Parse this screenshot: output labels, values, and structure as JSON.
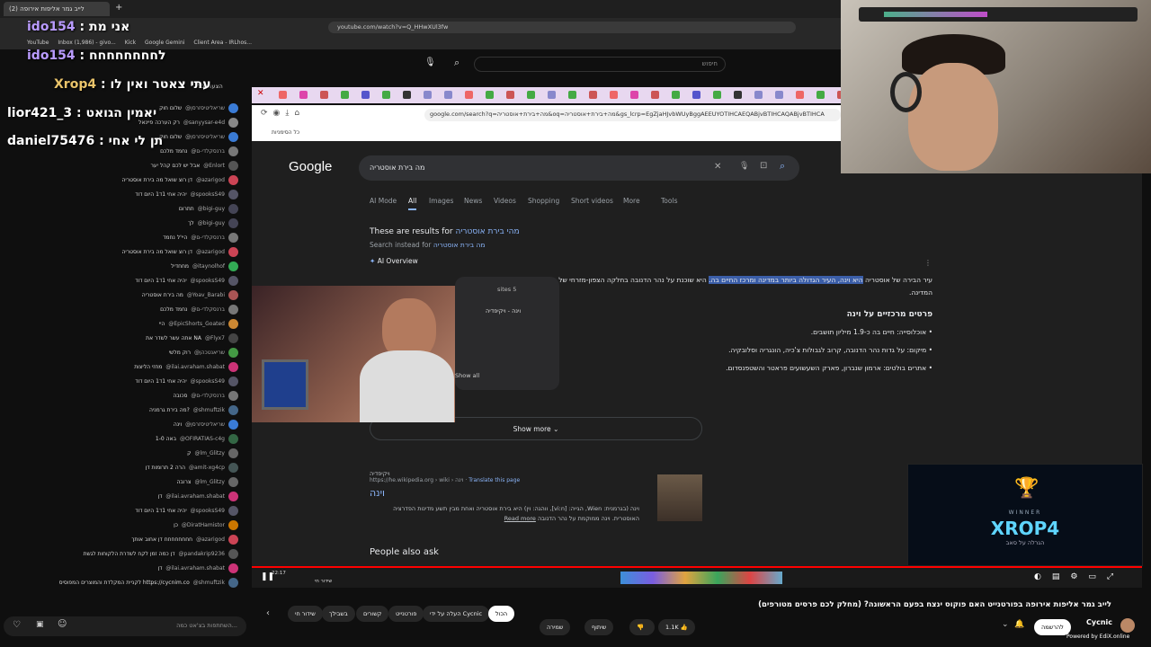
{
  "yt_browser": {
    "tab_title": "(2) לייב גמר אליפות אירופה",
    "url": "youtube.com/watch?v=Q_HHwXUl3fw",
    "bookmarks": [
      "YouTube",
      "Inbox (1,986) - givo...",
      "Kick",
      "Google Gemini",
      "Client Area - IRLhos..."
    ],
    "search_placeholder": "חיפוש"
  },
  "overlay_chat": [
    {
      "user": "ido154",
      "text": ": אני מת"
    },
    {
      "user": "ido154",
      "text": ": לחחחחחחחח"
    },
    {
      "user": "Xrop4",
      "text": ": עתי צאטר ואין לו"
    },
    {
      "user": "lior421_3",
      "text": ": יאמין הגואט"
    },
    {
      "user": "daniel75476",
      "text": ": תן לי אחי"
    }
  ],
  "chat": {
    "header": "הצעות בל",
    "messages": [
      {
        "user": "@שריאליטיסזרסן",
        "text": "שלום חוק",
        "color": "#3a7bd5"
      },
      {
        "user": "@sanyysar-e4d",
        "text": "רק הערכה פיינאל",
        "color": "#888"
      },
      {
        "user": "@שריאליטיסזרסן",
        "text": "שלום חוק",
        "color": "#3a7bd5"
      },
      {
        "user": "@ברנסקלדי-ם",
        "text": "נחמד מלכם",
        "color": "#777"
      },
      {
        "user": "@Enlort",
        "text": "אבל יש לכם קהל יער",
        "color": "#555"
      },
      {
        "user": "@azarigod",
        "text": "דן רוצ שואל מה בירת אוסטריה",
        "color": "#c45"
      },
      {
        "user": "@spooksS49",
        "text": "יהיה אחי 1ד1 היום דוד",
        "color": "#556"
      },
      {
        "user": "@bigi-guy",
        "text": "תתרום",
        "color": "#445"
      },
      {
        "user": "@bigi-guy",
        "text": "לך",
        "color": "#445"
      },
      {
        "user": "@ברנסקלדי-ם",
        "text": "היי'ל נחמד",
        "color": "#777"
      },
      {
        "user": "@azarigod",
        "text": "דן רוצ שואל מה בירת אוסטריה",
        "color": "#c45"
      },
      {
        "user": "@itaynolhof",
        "text": "מחחדיל",
        "color": "#3a5"
      },
      {
        "user": "@spooksS49",
        "text": "יהיה אחי 1ד1 היום דוד",
        "color": "#556"
      },
      {
        "user": "@Yoav_Barabi",
        "text": "מה בירת אוסטריה",
        "color": "#a55"
      },
      {
        "user": "@ברנסקלדי-ם",
        "text": "נחמד מלכם",
        "color": "#777"
      },
      {
        "user": "@EpicShorts_Goated",
        "text": "היי",
        "color": "#c83"
      },
      {
        "user": "@Flyx7",
        "text": "אתה עשר לשדר את NA",
        "color": "#444"
      },
      {
        "user": "@שריאנטכהן",
        "text": "רוק מלשי",
        "color": "#494"
      },
      {
        "user": "@ilai.avraham.shabat",
        "text": "מחזי הליצות",
        "color": "#c37"
      },
      {
        "user": "@spooksS49",
        "text": "יהיה אחי 1ד1 היום דוד",
        "color": "#556"
      },
      {
        "user": "@ברנסקלדי-ם",
        "text": "סכובה",
        "color": "#777"
      },
      {
        "user": "@shmuftzik",
        "text": "מה בירת גרמניה?",
        "color": "#468"
      },
      {
        "user": "@שריאליטיסזרסן",
        "text": "וינה",
        "color": "#3a7bd5"
      },
      {
        "user": "@OFIRATIAS-c4g",
        "text": "1-0 באה",
        "color": "#364"
      },
      {
        "user": "@lm_Glitzy",
        "text": "ק",
        "color": "#666"
      },
      {
        "user": "@amit-xg4cp",
        "text": "הרה 2 תרומות דן",
        "color": "#455"
      },
      {
        "user": "@lm_Glitzy",
        "text": "צרובה",
        "color": "#666"
      },
      {
        "user": "@ilai.avraham.shabat",
        "text": "דן",
        "color": "#c37"
      },
      {
        "user": "@spooksS49",
        "text": "יהיה אחי 1ד1 היום דוד",
        "color": "#556"
      },
      {
        "user": "@DiratHamistor",
        "text": "כן",
        "color": "#c70"
      },
      {
        "user": "@azarigod",
        "text": "חחחחחחחח דן אחוב אותך",
        "color": "#c45"
      },
      {
        "user": "@pandakrip9236",
        "text": "דן כמה זמן לקח לשדרת הלקוחות לגשת",
        "color": "#555"
      },
      {
        "user": "@ilai.avraham.shabat",
        "text": "דן",
        "color": "#c37"
      },
      {
        "user": "@shmuftzik",
        "text": "לקניית המקלדת והמוצרים המפוסיס https://cycnim.co",
        "color": "#468"
      }
    ],
    "input_placeholder": "השתתפות בצ'אט כמה..."
  },
  "inner_browser": {
    "url": "google.com/search?q=מה+בירת+אוסטריה&oq=מה+בירת+אוסטריה&gs_lcrp=EgZjaHJvbWUyBggAEEUYOTIHCAEQABjvBTIHCAQABjvBTIHCA",
    "bookmark": "כל הסימניות"
  },
  "google": {
    "logo": "Google",
    "query": "מה בירת אוסטריה",
    "tabs": [
      "AI Mode",
      "All",
      "Images",
      "News",
      "Videos",
      "Shopping",
      "Short videos",
      "More",
      "Tools"
    ],
    "results_for_prefix": "These are results for",
    "results_for_link": "מהי בירת אוסטריה",
    "search_instead_prefix": "Search instead for",
    "search_instead_link": "מה בירת אוסטריה",
    "ai_overview": "AI Overview",
    "overview_p1": "עיר הבירה של אוסטריה",
    "overview_p1_hl": "היא וינה, העיר הגדולה ביותר במדינה ומרכז החיים בה.",
    "overview_p1_rest": "היא שוכנת על נהר הדנובה בחלקה הצפון-מזרחי של המדינה.",
    "details_title": "פרטים מרכזיים על וינה",
    "details": [
      "אוכלוסייה: חיים בה כ-1.9 מיליון תושבים.",
      "מיקום: על גדות נהר הדנובה, קרוב לגבולות צ'כיה, הונגריה וסלובקיה.",
      "אתרים בולטים: ארמון שנברון, פארק השעשועים פראטר והשטפנסדום."
    ],
    "sites_label": "sites 5",
    "source_card_title": "וינה - ויקיפדיה",
    "show_all": "Show all",
    "show_more": "Show more",
    "wiki_source": "ויקיפדיה",
    "wiki_url": "https://he.wikipedia.org › wiki › וינה",
    "translate": "Translate this page",
    "wiki_title": "וינה",
    "wiki_snippet": "וינה (בגרמנית: Wien, הגייה: [viːn], ווהגה: וין) היא בירת אוסטריה ואחת מבין תשע מדינות הפדרציה האוסטרית. וינה ממוקמת על נהר הדנובה",
    "read_more": "Read more",
    "people_also_ask": "People also ask"
  },
  "winner": {
    "label": "WINNER",
    "name": "XROP4",
    "sub": "הגרלה על סאב"
  },
  "yt_bottom": {
    "video_title": "לייב גמר אליפות אירופה בפורטנייט האם פוקוס ינצח בפעם הראשונה? (מחלק לכם פרסים מטורפים)",
    "channel": "Cycnic",
    "subscribe": "להרשמה",
    "likes": "1.1K",
    "share": "שיתוף",
    "save": "שמירה",
    "chips": [
      "הכול",
      "העלה על ידי Cycnic",
      "פורטנייט",
      "קשורים",
      "בשבילך",
      "שידור חי"
    ],
    "time": "22:17",
    "live": "שידור חי",
    "edix": "Powered by EdiX.online"
  }
}
